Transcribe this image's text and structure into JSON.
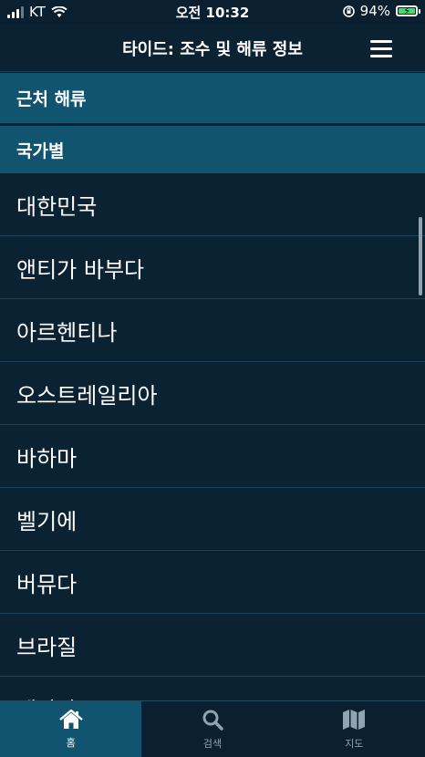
{
  "status_bar": {
    "carrier": "KT",
    "time": "오전 10:32",
    "battery_percent": "94%"
  },
  "nav": {
    "title": "타이드: 조수 및 해류 정보",
    "menu_icon": "hamburger-menu-icon"
  },
  "sections": {
    "nearby": "근처 해류",
    "by_country": "국가별"
  },
  "countries": [
    "대한민국",
    "앤티가 바부다",
    "아르헨티나",
    "오스트레일리아",
    "바하마",
    "벨기에",
    "버뮤다",
    "브라질",
    "캐나다"
  ],
  "tabs": [
    {
      "label": "홈",
      "icon": "home-icon",
      "active": true
    },
    {
      "label": "검색",
      "icon": "search-icon",
      "active": false
    },
    {
      "label": "지도",
      "icon": "map-icon",
      "active": false
    }
  ],
  "colors": {
    "background": "#0b2233",
    "section_header": "#115470",
    "active_tab": "#115470",
    "inactive_tab_text": "#8fa3b2",
    "battery_fill": "#4cd964"
  }
}
